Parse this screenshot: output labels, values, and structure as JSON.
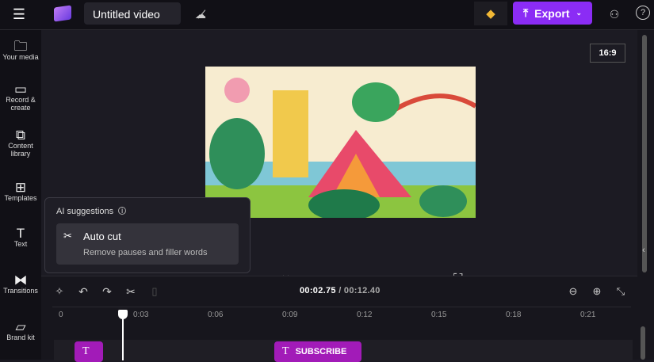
{
  "header": {
    "title": "Untitled video",
    "export_label": "Export"
  },
  "sidebar": {
    "items": [
      {
        "label": "Your media",
        "icon": "folder-icon"
      },
      {
        "label": "Record & create",
        "icon": "camera-icon"
      },
      {
        "label": "Content library",
        "icon": "library-icon"
      },
      {
        "label": "Templates",
        "icon": "templates-icon"
      },
      {
        "label": "Text",
        "icon": "text-icon"
      },
      {
        "label": "Transitions",
        "icon": "transitions-icon"
      },
      {
        "label": "Brand kit",
        "icon": "brand-kit-icon"
      }
    ]
  },
  "preview": {
    "aspect_ratio": "16:9"
  },
  "ai_suggestions": {
    "title": "AI suggestions",
    "item_title": "Auto cut",
    "item_desc": "Remove pauses and filler words"
  },
  "timeline": {
    "current": "00:02.75",
    "total": "/ 00:12.40",
    "ticks": [
      "0",
      "0:03",
      "0:06",
      "0:09",
      "0:12",
      "0:15",
      "0:18",
      "0:21"
    ],
    "clips": [
      {
        "label": ""
      },
      {
        "label": "SUBSCRIBE"
      }
    ]
  },
  "colors": {
    "accent": "#8b2cf5",
    "clip": "#a21bb8"
  }
}
